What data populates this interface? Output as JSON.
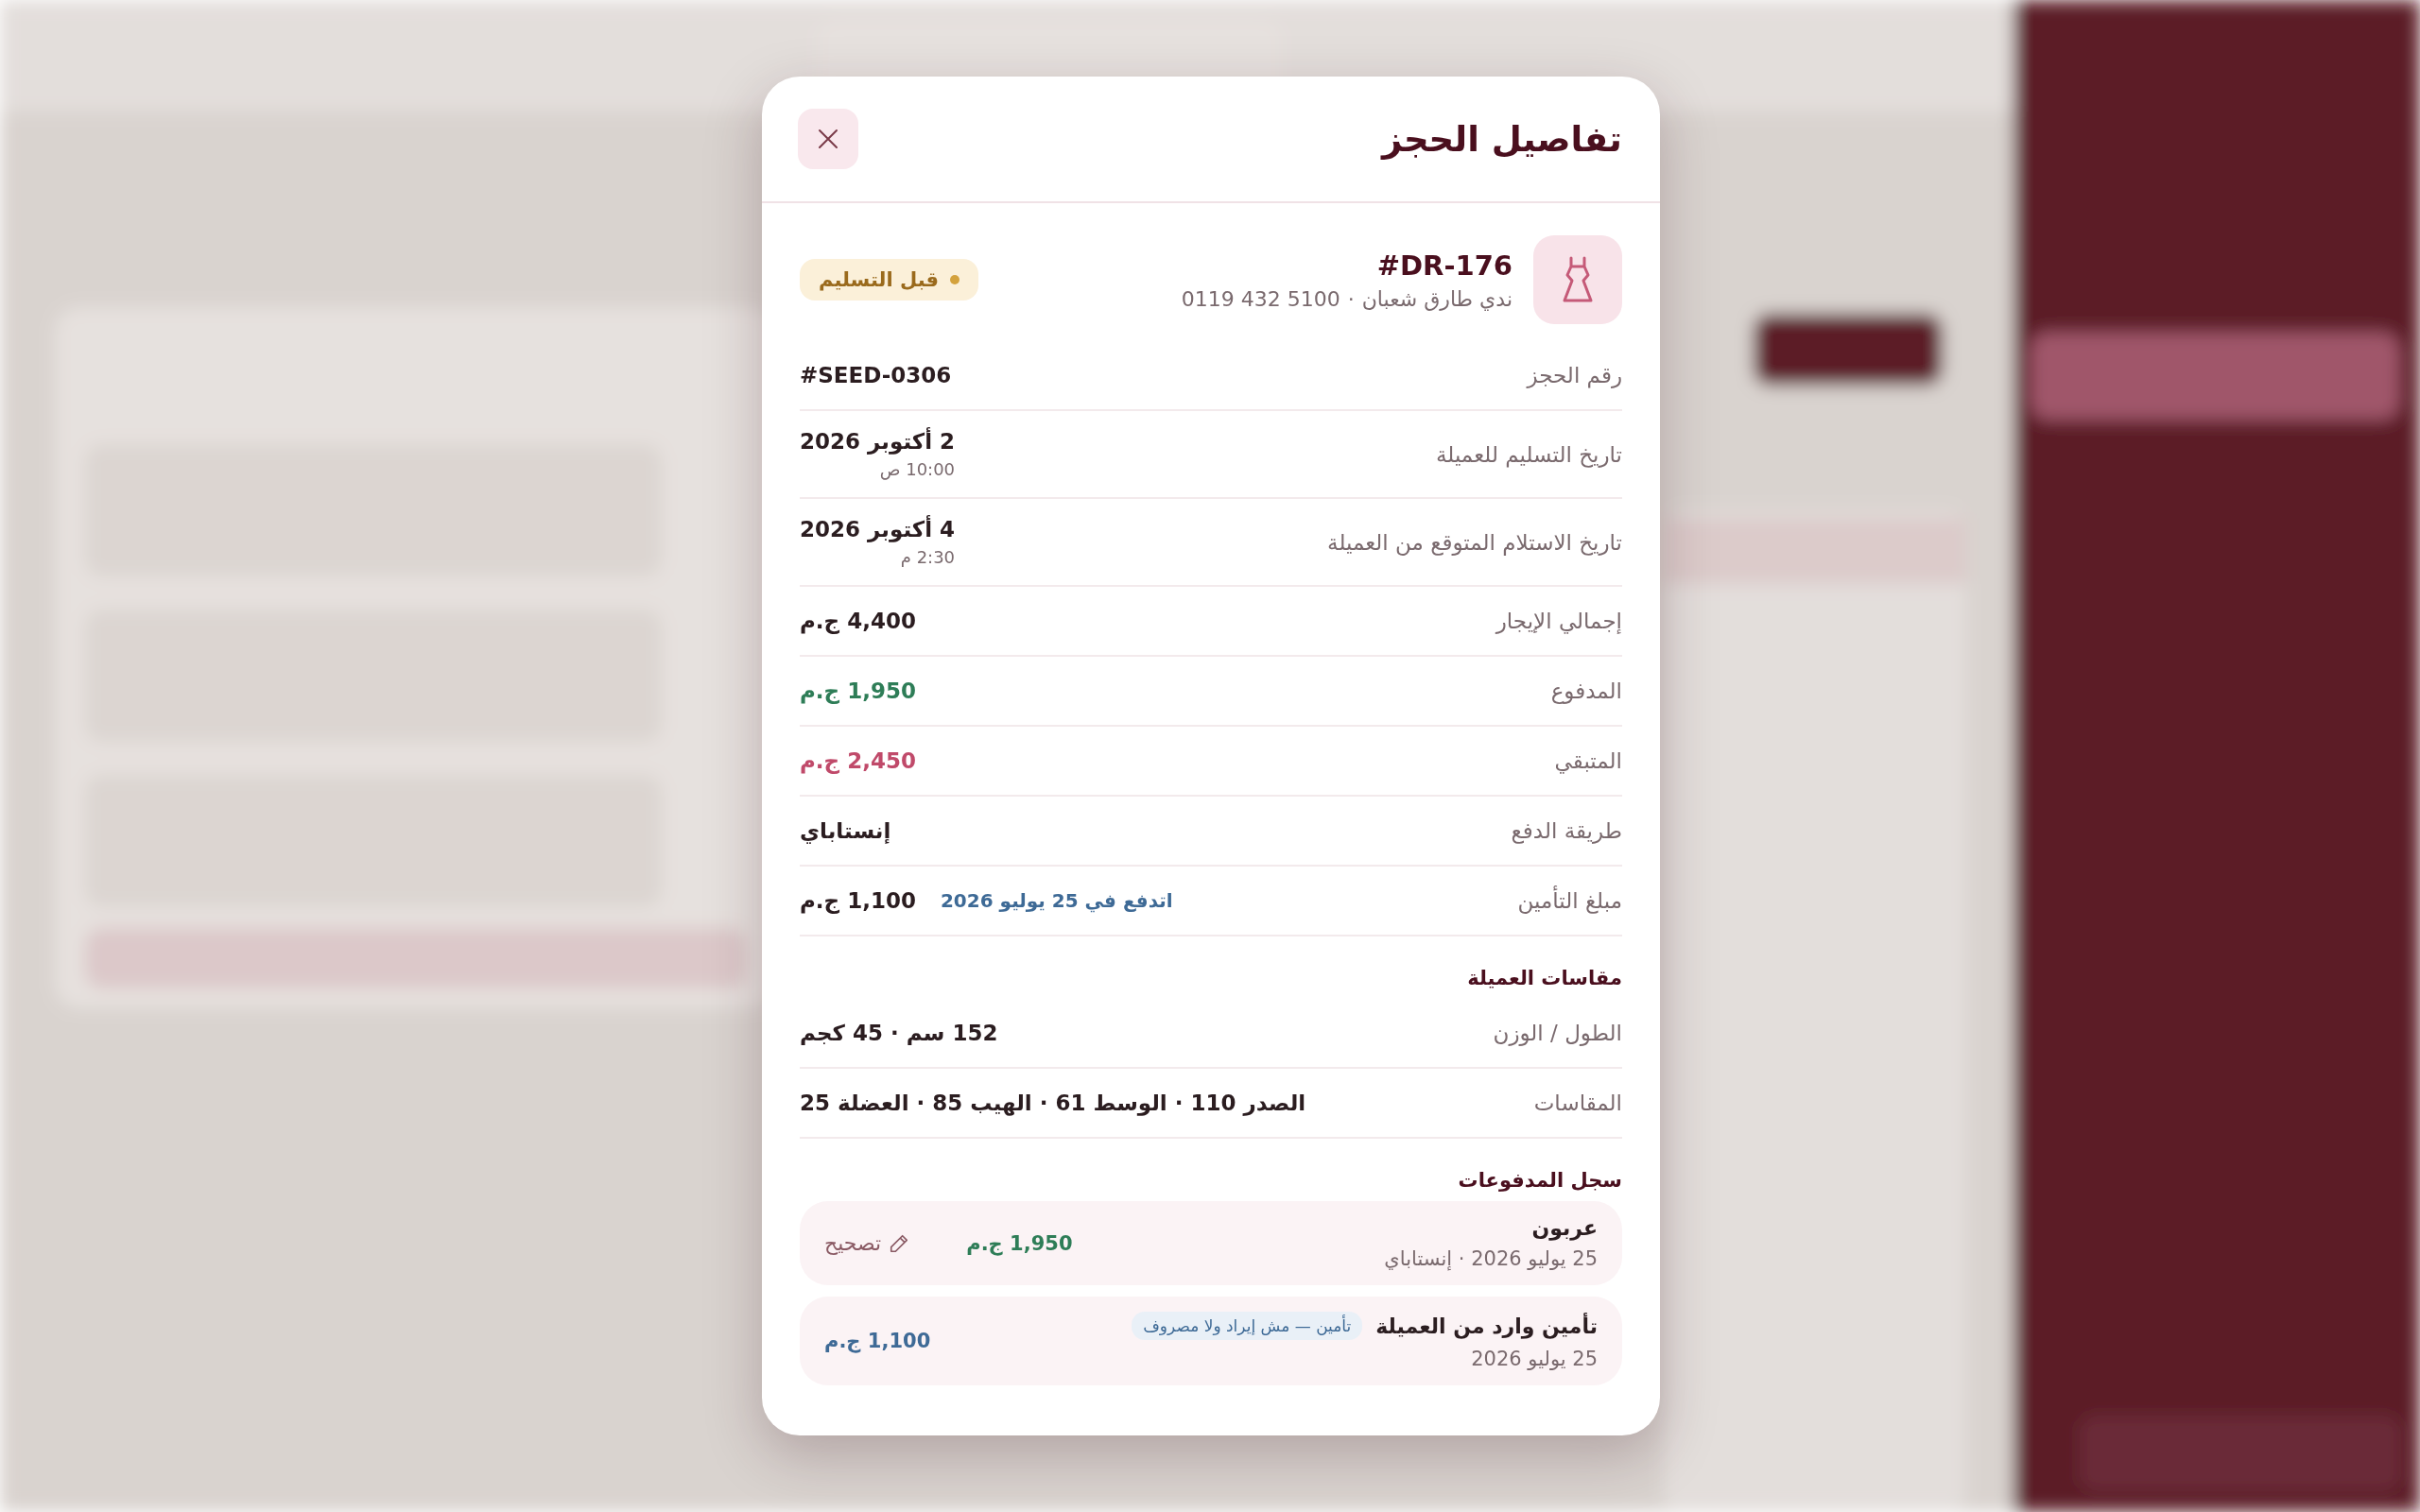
{
  "modal": {
    "title": "تفاصيل الحجز"
  },
  "booking": {
    "code": "#DR-176",
    "customer": [
      "ندي طارق شعبان",
      "·",
      "0119 432 5100"
    ],
    "status": "قبل التسليم"
  },
  "details": [
    {
      "label": "رقم الحجز",
      "value": "#SEED-0306",
      "kind": "plain"
    },
    {
      "label": "تاريخ التسليم للعميلة",
      "value": "2 أكتوبر 2026",
      "sub": "10:00 ص",
      "kind": "plain"
    },
    {
      "label": "تاريخ الاستلام المتوقع من العميلة",
      "value": "4 أكتوبر 2026",
      "sub": "2:30 م",
      "kind": "plain"
    },
    {
      "label": "إجمالي الإيجار",
      "value": "4,400 ج.م",
      "kind": "plain"
    },
    {
      "label": "المدفوع",
      "value": "1,950 ج.م",
      "kind": "paid"
    },
    {
      "label": "المتبقي",
      "value": "2,450 ج.م",
      "kind": "due"
    },
    {
      "label": "طريقة الدفع",
      "value": "إنستاباي",
      "kind": "plain"
    },
    {
      "label": "مبلغ التأمين",
      "value": "1,100 ج.م",
      "note": "اتدفع في 25 يوليو 2026",
      "kind": "plain"
    }
  ],
  "measurements": {
    "heading": "مقاسات العميلة",
    "rows": [
      {
        "label": "الطول / الوزن",
        "value": "152 سم · 45 كجم"
      },
      {
        "label": "المقاسات",
        "value": "الصدر 110 · الوسط 61 · الهيب 85 · العضلة 25"
      }
    ]
  },
  "payments": {
    "heading": "سجل المدفوعات",
    "items": [
      {
        "title": "عربون",
        "sub": "25 يوليو 2026 · إنستاباي",
        "amount": "1,950 ج.م",
        "kind": "paid",
        "action": "تصحيح"
      },
      {
        "title": "تأمين وارد من العميلة",
        "tag": "تأمين — مش إيراد ولا مصروف",
        "sub": "25 يوليو 2026",
        "amount": "1,100 ج.م",
        "kind": "deposit"
      }
    ]
  }
}
